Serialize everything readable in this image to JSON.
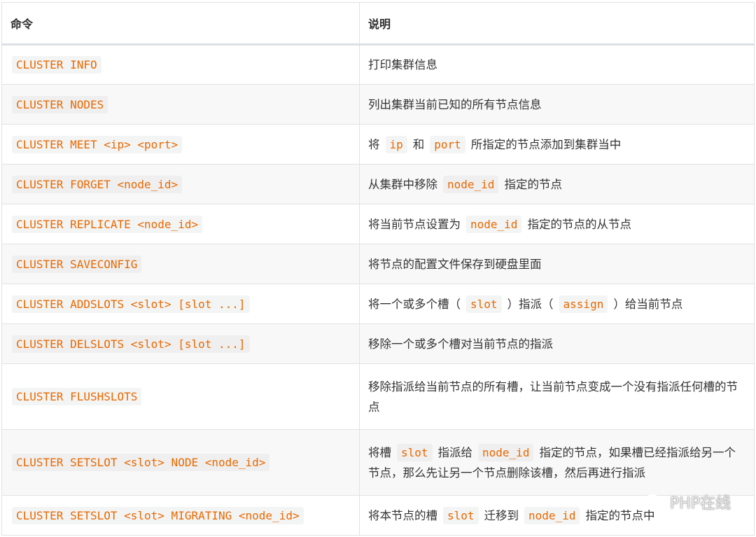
{
  "header": {
    "command": "命令",
    "description": "说明"
  },
  "rows": [
    {
      "cmd": "CLUSTER INFO",
      "desc": [
        {
          "t": "打印集群信息"
        }
      ]
    },
    {
      "cmd": "CLUSTER NODES",
      "desc": [
        {
          "t": "列出集群当前已知的所有节点信息"
        }
      ]
    },
    {
      "cmd": "CLUSTER MEET <ip> <port>",
      "desc": [
        {
          "t": "将"
        },
        {
          "c": "ip"
        },
        {
          "t": "和"
        },
        {
          "c": "port"
        },
        {
          "t": "所指定的节点添加到集群当中"
        }
      ]
    },
    {
      "cmd": "CLUSTER FORGET <node_id>",
      "desc": [
        {
          "t": "从集群中移除"
        },
        {
          "c": "node_id"
        },
        {
          "t": "指定的节点"
        }
      ]
    },
    {
      "cmd": "CLUSTER REPLICATE <node_id>",
      "desc": [
        {
          "t": "将当前节点设置为"
        },
        {
          "c": "node_id"
        },
        {
          "t": "指定的节点的从节点"
        }
      ]
    },
    {
      "cmd": "CLUSTER SAVECONFIG",
      "desc": [
        {
          "t": "将节点的配置文件保存到硬盘里面"
        }
      ]
    },
    {
      "cmd": "CLUSTER ADDSLOTS <slot> [slot ...]",
      "desc": [
        {
          "t": "将一个或多个槽（"
        },
        {
          "c": "slot"
        },
        {
          "t": "）指派（"
        },
        {
          "c": "assign"
        },
        {
          "t": "）给当前节点"
        }
      ]
    },
    {
      "cmd": "CLUSTER DELSLOTS <slot> [slot ...]",
      "desc": [
        {
          "t": "移除一个或多个槽对当前节点的指派"
        }
      ]
    },
    {
      "cmd": "CLUSTER FLUSHSLOTS",
      "desc": [
        {
          "t": "移除指派给当前节点的所有槽，让当前节点变成一个没有指派任何槽的节点"
        }
      ]
    },
    {
      "cmd": "CLUSTER SETSLOT <slot> NODE <node_id>",
      "desc": [
        {
          "t": "将槽"
        },
        {
          "c": "slot"
        },
        {
          "t": "指派给"
        },
        {
          "c": "node_id"
        },
        {
          "t": "指定的节点，如果槽已经指派给另一个节点，那么先让另一个节点删除该槽，然后再进行指派"
        }
      ]
    },
    {
      "cmd": "CLUSTER SETSLOT <slot> MIGRATING <node_id>",
      "desc": [
        {
          "t": "将本节点的槽"
        },
        {
          "c": "slot"
        },
        {
          "t": "迁移到"
        },
        {
          "c": "node_id"
        },
        {
          "t": "指定的节点中"
        }
      ]
    }
  ],
  "watermark": {
    "text": "PHP在线",
    "icon": "wechat-icon"
  },
  "colors": {
    "code_text": "#e96900",
    "code_bg": "#f3f4f4",
    "border": "#dfe2e5",
    "stripe": "#f8f8f8"
  }
}
